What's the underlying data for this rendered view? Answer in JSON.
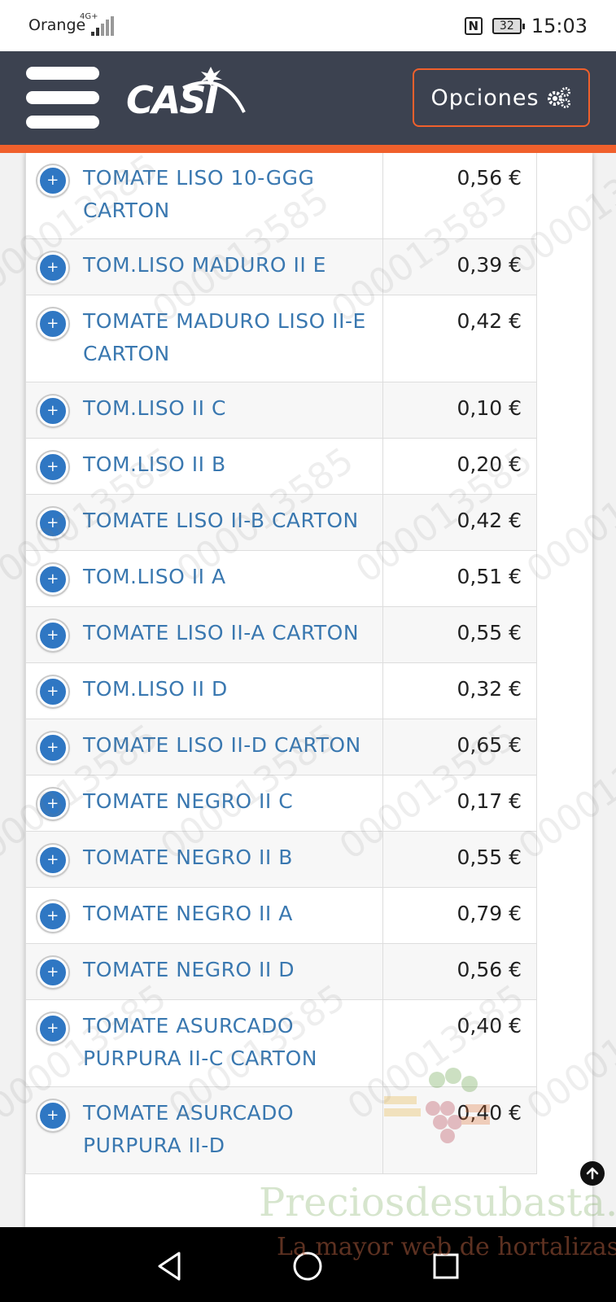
{
  "status_bar": {
    "carrier": "Orange",
    "network": "4G+",
    "battery": "32",
    "time": "15:03"
  },
  "header": {
    "logo_text": "CASI",
    "options_label": "Opciones"
  },
  "products": [
    {
      "name": "TOMATE LISO 10-GGG CARTON",
      "price": "0,56 €"
    },
    {
      "name": "TOM.LISO MADURO II E",
      "price": "0,39 €"
    },
    {
      "name": "TOMATE MADURO LISO II-E CARTON",
      "price": "0,42 €"
    },
    {
      "name": "TOM.LISO II C",
      "price": "0,10 €"
    },
    {
      "name": "TOM.LISO II B",
      "price": "0,20 €"
    },
    {
      "name": "TOMATE LISO II-B CARTON",
      "price": "0,42 €"
    },
    {
      "name": "TOM.LISO II A",
      "price": "0,51 €"
    },
    {
      "name": "TOMATE LISO II-A CARTON",
      "price": "0,55 €"
    },
    {
      "name": "TOM.LISO II D",
      "price": "0,32 €"
    },
    {
      "name": "TOMATE LISO II-D CARTON",
      "price": "0,65 €"
    },
    {
      "name": "TOMATE NEGRO II C",
      "price": "0,17 €"
    },
    {
      "name": "TOMATE NEGRO II B",
      "price": "0,55 €"
    },
    {
      "name": "TOMATE NEGRO II A",
      "price": "0,79 €"
    },
    {
      "name": "TOMATE NEGRO II D",
      "price": "0,56 €"
    },
    {
      "name": "TOMATE ASURCADO PURPURA II-C CARTON",
      "price": "0,40 €"
    },
    {
      "name": "TOMATE ASURCADO PURPURA II-D",
      "price": "0,40 €"
    }
  ],
  "watermark_text": "000013585",
  "overlay": {
    "brand": "Preciosdesubasta.com",
    "tagline": "La mayor web de hortalizas"
  },
  "colors": {
    "header_bg": "#3c4250",
    "accent": "#f0602c",
    "link": "#3a78b0",
    "plus_button": "#2f77c3"
  }
}
